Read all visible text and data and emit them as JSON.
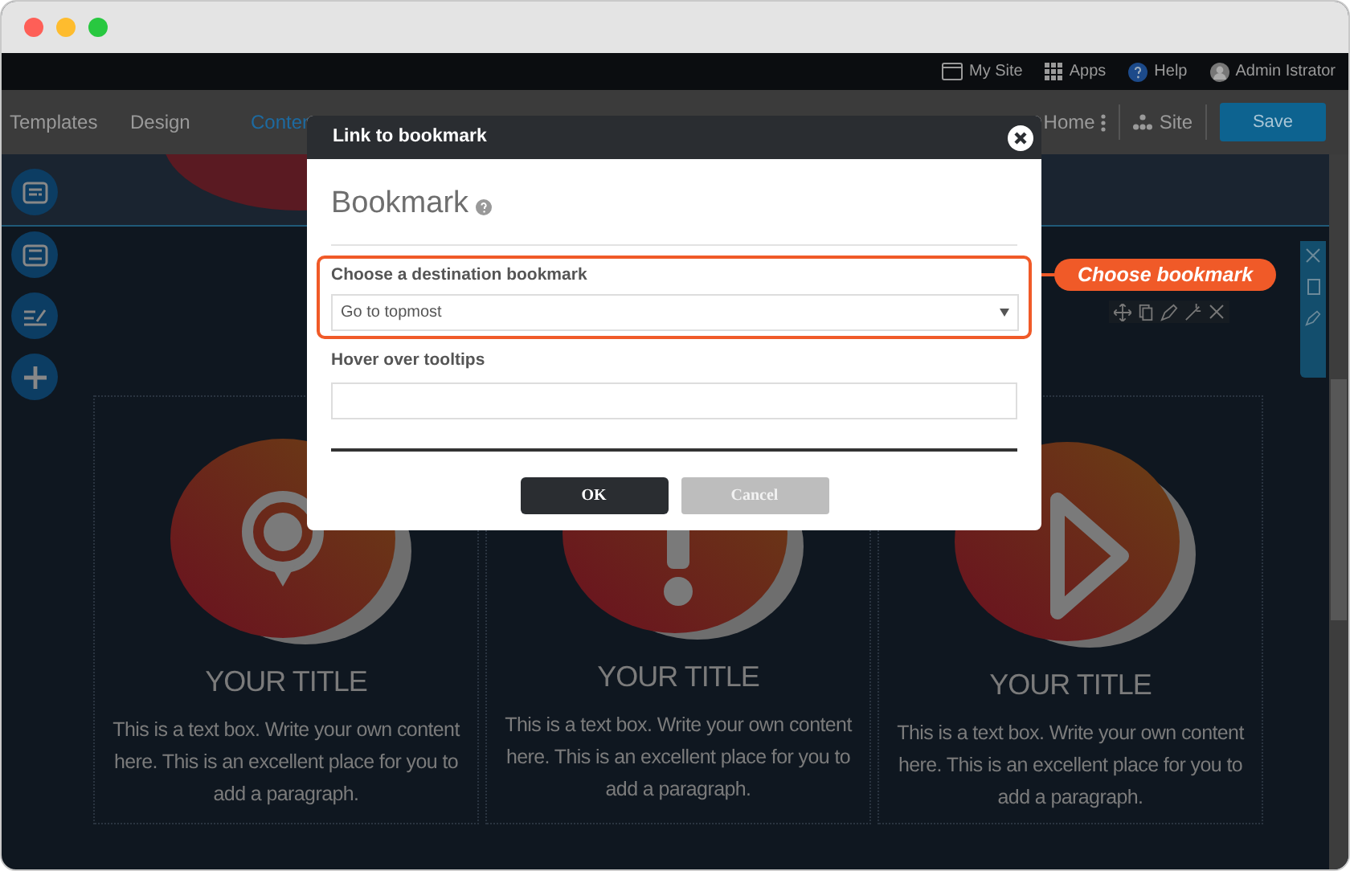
{
  "top_bar": {
    "items": [
      {
        "kind": "site",
        "label": "My Site"
      },
      {
        "kind": "apps",
        "label": "Apps"
      },
      {
        "kind": "help",
        "label": "Help"
      },
      {
        "kind": "user",
        "label": "Admin Istrator"
      }
    ]
  },
  "nav": {
    "tabs": [
      {
        "label": "Templates",
        "selected": false
      },
      {
        "label": "Design",
        "selected": false
      },
      {
        "label": "Conten",
        "selected": true
      }
    ],
    "page_menu": "Home",
    "site_menu": "Site",
    "save_button": "Save"
  },
  "features": [
    {
      "kind": "pin",
      "title": "YOUR TITLE",
      "text": "This is a text box. Write your own content here. This is an excellent place for you to add a paragraph."
    },
    {
      "kind": "info",
      "title": "YOUR TITLE",
      "text": "This is a text box. Write your own content here. This is an excellent place for you to add a paragraph."
    },
    {
      "kind": "play",
      "title": "YOUR TITLE",
      "text": "This is a text box. Write your own content here. This is an excellent place for you to add a paragraph."
    }
  ],
  "dialog": {
    "title": "Link to bookmark",
    "heading": "Bookmark",
    "destination": {
      "label": "Choose a destination bookmark",
      "value": "Go to topmost",
      "highlighted": true
    },
    "tooltip": {
      "label": "Hover over tooltips"
    },
    "buttons": [
      {
        "label": "OK",
        "kind": "primary"
      },
      {
        "label": "Cancel",
        "kind": "secondary"
      }
    ]
  },
  "callout": {
    "text": "Choose bookmark"
  }
}
